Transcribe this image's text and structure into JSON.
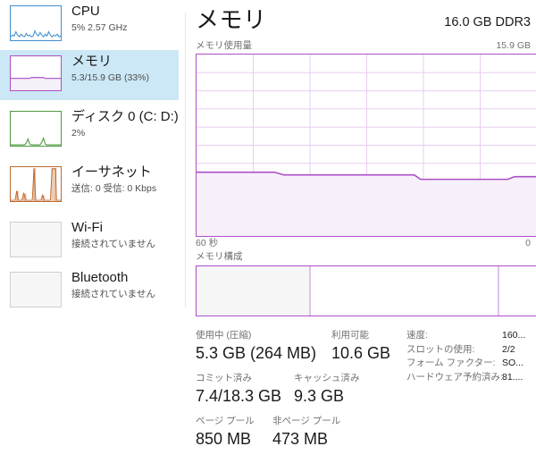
{
  "sidebar": {
    "items": [
      {
        "id": "cpu",
        "title": "CPU",
        "subtitle": "5%  2.57 GHz",
        "accent": "#3f8fd2",
        "selected": false
      },
      {
        "id": "memory",
        "title": "メモリ",
        "subtitle": "5.3/15.9 GB (33%)",
        "accent": "#ac4fc6",
        "selected": true
      },
      {
        "id": "disk0",
        "title": "ディスク 0 (C: D:)",
        "subtitle": "2%",
        "accent": "#4e9a3e",
        "selected": false
      },
      {
        "id": "ethernet",
        "title": "イーサネット",
        "subtitle": "送信: 0 受信: 0 Kbps",
        "accent": "#bd6a32",
        "selected": false
      },
      {
        "id": "wifi",
        "title": "Wi-Fi",
        "subtitle": "接続されていません",
        "accent": "#cfcfcf",
        "selected": false
      },
      {
        "id": "bluetooth",
        "title": "Bluetooth",
        "subtitle": "接続されていません",
        "accent": "#cfcfcf",
        "selected": false
      }
    ]
  },
  "main": {
    "title": "メモリ",
    "hardware_spec": "16.0 GB DDR3",
    "graph": {
      "label": "メモリ使用量",
      "max_label": "15.9 GB",
      "axis_left": "60 秒",
      "axis_right": "0"
    },
    "composition": {
      "label": "メモリ構成",
      "segments": [
        {
          "name": "in-use",
          "percent": 33.0
        },
        {
          "name": "available",
          "percent": 55.5
        },
        {
          "name": "reserved",
          "percent": 11.5
        }
      ]
    },
    "stats": [
      {
        "key": "使用中 (圧縮)",
        "value": "5.3 GB (264 MB)"
      },
      {
        "key": "利用可能",
        "value": "10.6 GB"
      },
      {
        "key": "コミット済み",
        "value": "7.4/18.3 GB"
      },
      {
        "key": "キャッシュ済み",
        "value": "9.3 GB"
      },
      {
        "key": "ページ プール",
        "value": "850 MB"
      },
      {
        "key": "非ページ プール",
        "value": "473 MB"
      }
    ],
    "spec_table": [
      {
        "key": "速度:",
        "value": "160..."
      },
      {
        "key": "スロットの使用:",
        "value": "2/2"
      },
      {
        "key": "フォーム ファクター:",
        "value": "SO..."
      },
      {
        "key": "ハードウェア予約済み:",
        "value": "81...."
      }
    ]
  },
  "chart_data": {
    "type": "area",
    "title": "メモリ使用量",
    "xlabel": "",
    "ylabel": "",
    "ylim": [
      0,
      15.9
    ],
    "xlim": [
      60,
      0
    ],
    "x_tick_labels": [
      "60 秒",
      "0"
    ],
    "y_max_label": "15.9 GB",
    "grid": true,
    "grid_columns": 6,
    "grid_rows": 10,
    "line_color": "#ac4fc6",
    "fill_color": "#f6eefa",
    "series": [
      {
        "name": "メモリ使用量 (GB)",
        "x": [
          60,
          55,
          50,
          45,
          40,
          35,
          30,
          25,
          20,
          15,
          10,
          5,
          0
        ],
        "values": [
          5.3,
          5.3,
          5.3,
          5.3,
          5.25,
          5.25,
          5.25,
          5.25,
          5.15,
          5.15,
          5.15,
          5.2,
          5.2
        ]
      }
    ]
  }
}
